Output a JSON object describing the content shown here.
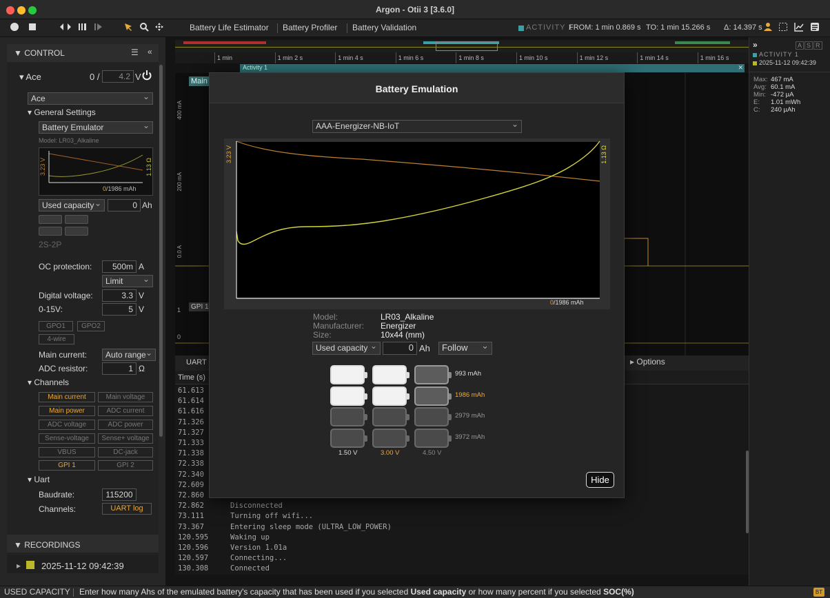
{
  "window": {
    "title": "Argon - Otii 3 [3.6.0]"
  },
  "toolbar": {
    "nav": [
      "Battery Life Estimator",
      "Battery Profiler",
      "Battery Validation"
    ],
    "activity": "ACTIVITY 1",
    "from": "FROM: 1 min 0.869 s",
    "to": "TO: 1 min 15.266 s",
    "delta": "Δ: 14.397 s"
  },
  "control": {
    "header": "CONTROL",
    "device": "Ace",
    "voltage_prefix": "0 /",
    "voltage_value": "4.2",
    "voltage_unit": "V",
    "device_select": "Ace",
    "general_settings": "General Settings",
    "mode_select": "Battery Emulator",
    "model": "Model: LR03_Alkaline",
    "mini_v": "3.23 V",
    "mini_r": "1.13 Ω",
    "mini_cap_used": "0",
    "mini_cap": "/1986 mAh",
    "used_cap_select": "Used capacity",
    "used_cap_value": "0",
    "used_cap_unit": "Ah",
    "config": "2S-2P",
    "oc_label": "OC protection:",
    "oc_value": "500m",
    "oc_unit": "A",
    "oc_mode": "Limit",
    "dv_label": "Digital voltage:",
    "dv_value": "3.3",
    "dv_unit": "V",
    "v15_label": "0-15V:",
    "v15_value": "5",
    "v15_unit": "V",
    "gpo1": "GPO1",
    "gpo2": "GPO2",
    "wire": "4-wire",
    "main_current_label": "Main current:",
    "main_current_value": "Auto range",
    "adc_res_label": "ADC resistor:",
    "adc_res_value": "1",
    "adc_res_unit": "Ω",
    "channels_label": "Channels",
    "channels": [
      "Main current",
      "Main voltage",
      "Main power",
      "ADC current",
      "ADC voltage",
      "ADC power",
      "Sense-voltage",
      "Sense+ voltage",
      "VBUS",
      "DC-jack",
      "GPI 1",
      "GPI 2"
    ],
    "uart_label": "Uart",
    "baud_label": "Baudrate:",
    "baud_value": "115200",
    "uart_channels_label": "Channels:",
    "uart_channels_value": "UART log",
    "recordings_header": "RECORDINGS",
    "recording_name": "2025-11-12 09:42:39"
  },
  "timeline": {
    "ticks": [
      "1 min",
      "1 min 2 s",
      "1 min 4 s",
      "1 min 6 s",
      "1 min 8 s",
      "1 min 10 s",
      "1 min 12 s",
      "1 min 14 s",
      "1 min 16 s"
    ],
    "activity_label": "Activity 1",
    "main_tab": "Main",
    "y_labels": [
      "400 mA",
      "200 mA",
      "0.0 A"
    ],
    "gpi_tab": "GPI 1",
    "gpi_y": [
      "1",
      "0"
    ],
    "uart_tab": "UART",
    "options": "Options",
    "time_header": "Time (s)"
  },
  "log": [
    {
      "t": "61.613",
      "m": ""
    },
    {
      "t": "61.614",
      "m": ""
    },
    {
      "t": "61.616",
      "m": ""
    },
    {
      "t": "71.326",
      "m": ""
    },
    {
      "t": "71.327",
      "m": ""
    },
    {
      "t": "71.333",
      "m": ""
    },
    {
      "t": "71.338",
      "m": ""
    },
    {
      "t": "72.338",
      "m": ""
    },
    {
      "t": "72.340",
      "m": ""
    },
    {
      "t": "72.609",
      "m": ""
    },
    {
      "t": "72.860",
      "m": ""
    },
    {
      "t": "72.862",
      "m": "Disconnected"
    },
    {
      "t": "73.111",
      "m": "Turning off wifi..."
    },
    {
      "t": "73.367",
      "m": "Entering sleep mode (ULTRA_LOW_POWER)"
    },
    {
      "t": "120.595",
      "m": "Waking up"
    },
    {
      "t": "120.596",
      "m": "Version 1.01a"
    },
    {
      "t": "120.597",
      "m": "Connecting..."
    },
    {
      "t": "130.308",
      "m": "Connected"
    }
  ],
  "stats": {
    "activity": "ACTIVITY 1",
    "recording": "2025-11-12 09:42:39",
    "flags": [
      "A",
      "S",
      "R"
    ],
    "rows": [
      {
        "k": "Max:",
        "v": "467 mA"
      },
      {
        "k": "Avg:",
        "v": "60.1 mA"
      },
      {
        "k": "Min:",
        "v": "-472 µA"
      },
      {
        "k": "E:",
        "v": "1.01 mWh"
      },
      {
        "k": "C:",
        "v": "240 µAh"
      }
    ]
  },
  "modal": {
    "title": "Battery Emulation",
    "profile": "AAA-Energizer-NB-IoT",
    "v_label": "3.23 V",
    "r_label": "1.13 Ω",
    "cap_used": "0",
    "cap_total": "/1986 mAh",
    "model_label": "Model:",
    "model_value": "LR03_Alkaline",
    "manu_label": "Manufacturer:",
    "manu_value": "Energizer",
    "size_label": "Size:",
    "size_value": "10x44 (mm)",
    "used_select": "Used capacity",
    "used_value": "0",
    "used_unit": "Ah",
    "follow": "Follow",
    "caps": [
      "993 mAh",
      "1986 mAh",
      "2979 mAh",
      "3972 mAh"
    ],
    "volts": [
      "1.50 V",
      "3.00 V",
      "4.50 V"
    ],
    "hide": "Hide",
    "grid_state": [
      [
        1,
        1,
        0
      ],
      [
        1,
        1,
        0
      ],
      [
        0,
        0,
        0
      ],
      [
        0,
        0,
        0
      ]
    ],
    "colors": {
      "accent": "#f0a83a",
      "voltage_curve": "#c9c93a",
      "resistance_curve": "#c08030"
    }
  },
  "status": {
    "label": "USED CAPACITY",
    "pre": "Enter how many Ahs of the emulated battery's capacity that has been used if you selected ",
    "b1": "Used capacity",
    "mid": " or how many percent if you selected ",
    "b2": "SOC(%)",
    "badge": "BT"
  }
}
